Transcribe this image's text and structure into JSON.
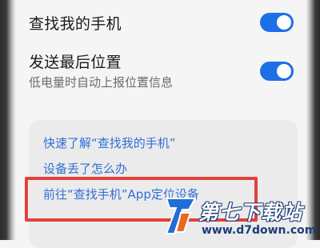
{
  "settings": {
    "find_my_phone": {
      "label": "查找我的手机",
      "enabled": true
    },
    "send_last_location": {
      "label": "发送最后位置",
      "description": "低电量时自动上报位置信息",
      "enabled": true
    }
  },
  "help_card": {
    "links": [
      {
        "label": "快速了解“查找我的手机”"
      },
      {
        "label": "设备丢了怎么办"
      },
      {
        "label": "前往“查找手机”App定位设备"
      }
    ]
  },
  "colors": {
    "toggle_on": "#1d6fe6",
    "link": "#2f6fd6",
    "highlight_border": "#e0423a",
    "background": "#f5f5f5",
    "card": "#ebebeb"
  },
  "watermark": {
    "title": "第七下载站",
    "url": "www.d7down.com"
  }
}
